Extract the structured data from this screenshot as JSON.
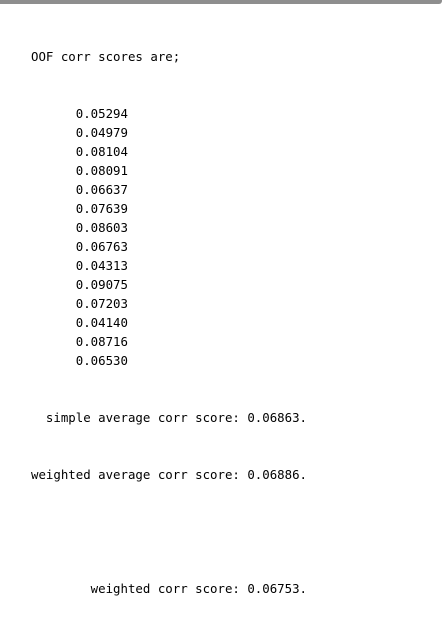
{
  "output": {
    "header": "OOF corr scores are;",
    "scores": [
      "0.05294",
      "0.04979",
      "0.08104",
      "0.08091",
      "0.06637",
      "0.07639",
      "0.08603",
      "0.06763",
      "0.04313",
      "0.09075",
      "0.07203",
      "0.04140",
      "0.08716",
      "0.06530"
    ],
    "simple_average": "  simple average corr score: 0.06863.",
    "weighted_average": "weighted average corr score: 0.06886.",
    "weighted_score": "        weighted corr score: 0.06753."
  }
}
